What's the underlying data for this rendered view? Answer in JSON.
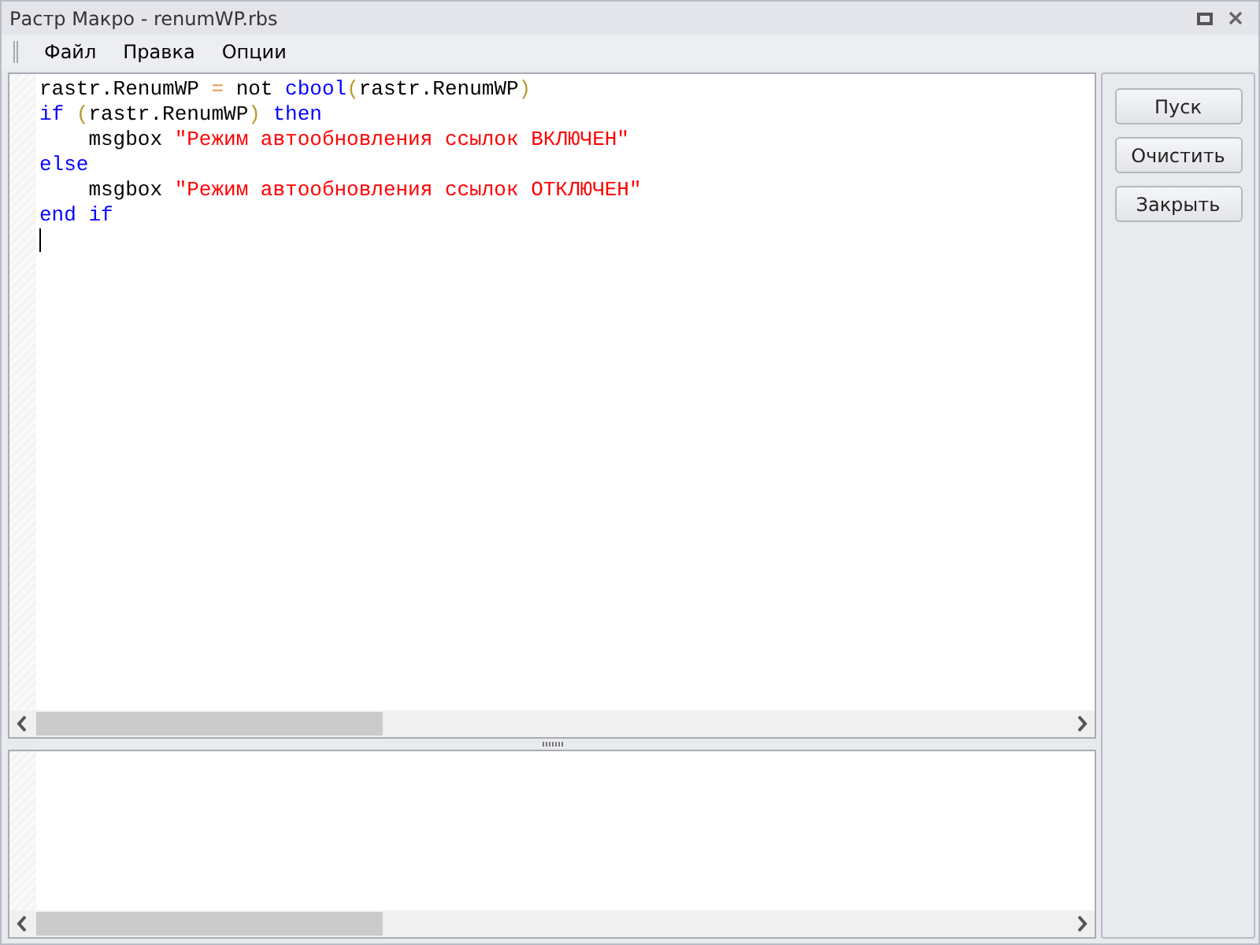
{
  "window": {
    "title": "Растр Макро - renumWP.rbs"
  },
  "menu": [
    {
      "label": "Файл"
    },
    {
      "label": "Правка"
    },
    {
      "label": "Опции"
    }
  ],
  "editor": {
    "lines": [
      [
        {
          "text": "rastr.RenumWP ",
          "kind": "plain"
        },
        {
          "text": "=",
          "kind": "operator"
        },
        {
          "text": " not ",
          "kind": "plain"
        },
        {
          "text": "cbool",
          "kind": "keyword"
        },
        {
          "text": "(",
          "kind": "paren"
        },
        {
          "text": "rastr.RenumWP",
          "kind": "plain"
        },
        {
          "text": ")",
          "kind": "paren"
        }
      ],
      [
        {
          "text": "if",
          "kind": "keyword"
        },
        {
          "text": " (",
          "kind": "paren"
        },
        {
          "text": "rastr.RenumWP",
          "kind": "plain"
        },
        {
          "text": ") ",
          "kind": "paren"
        },
        {
          "text": "then",
          "kind": "keyword"
        }
      ],
      [
        {
          "text": "    msgbox ",
          "kind": "plain"
        },
        {
          "text": "\"Режим автообновления ссылок ВКЛЮЧЕН\"",
          "kind": "string"
        }
      ],
      [
        {
          "text": "else",
          "kind": "keyword"
        }
      ],
      [
        {
          "text": "    msgbox ",
          "kind": "plain"
        },
        {
          "text": "\"Режим автообновления ссылок ОТКЛЮЧЕН\"",
          "kind": "string"
        }
      ],
      [
        {
          "text": "end if",
          "kind": "keyword"
        }
      ]
    ]
  },
  "buttons": [
    {
      "label": "Пуск"
    },
    {
      "label": "Очистить"
    },
    {
      "label": "Закрыть"
    }
  ]
}
